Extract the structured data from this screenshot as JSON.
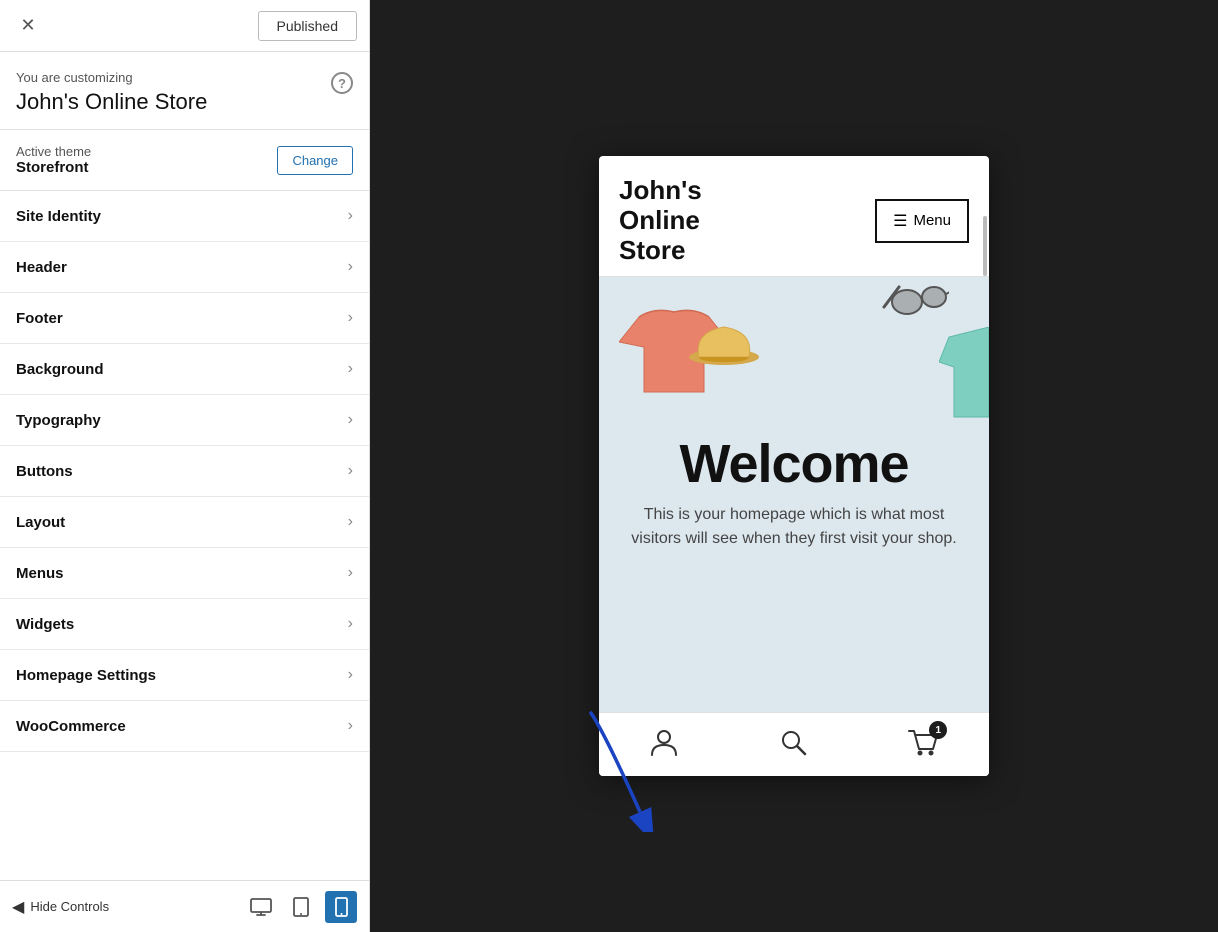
{
  "topBar": {
    "closeLabel": "✕",
    "publishedLabel": "Published"
  },
  "customizing": {
    "subtitle": "You are customizing",
    "storeName": "John's Online Store",
    "helpIcon": "?"
  },
  "activeTheme": {
    "label": "Active theme",
    "themeName": "Storefront",
    "changeLabel": "Change"
  },
  "navItems": [
    {
      "label": "Site Identity"
    },
    {
      "label": "Header"
    },
    {
      "label": "Footer"
    },
    {
      "label": "Background"
    },
    {
      "label": "Typography"
    },
    {
      "label": "Buttons"
    },
    {
      "label": "Layout"
    },
    {
      "label": "Menus"
    },
    {
      "label": "Widgets"
    },
    {
      "label": "Homepage Settings"
    },
    {
      "label": "WooCommerce"
    }
  ],
  "bottomToolbar": {
    "hideControlsLabel": "Hide Controls",
    "devices": [
      {
        "name": "desktop",
        "icon": "🖥"
      },
      {
        "name": "tablet",
        "icon": "⬜"
      },
      {
        "name": "mobile",
        "icon": "📱",
        "active": true
      }
    ]
  },
  "preview": {
    "storeTitle": "John's\nOnline\nStore",
    "menuLabel": "Menu",
    "welcomeText": "Welcome",
    "heroDesc": "This is your homepage which is what most visitors will see when they first visit your shop.",
    "cartBadge": "1"
  }
}
